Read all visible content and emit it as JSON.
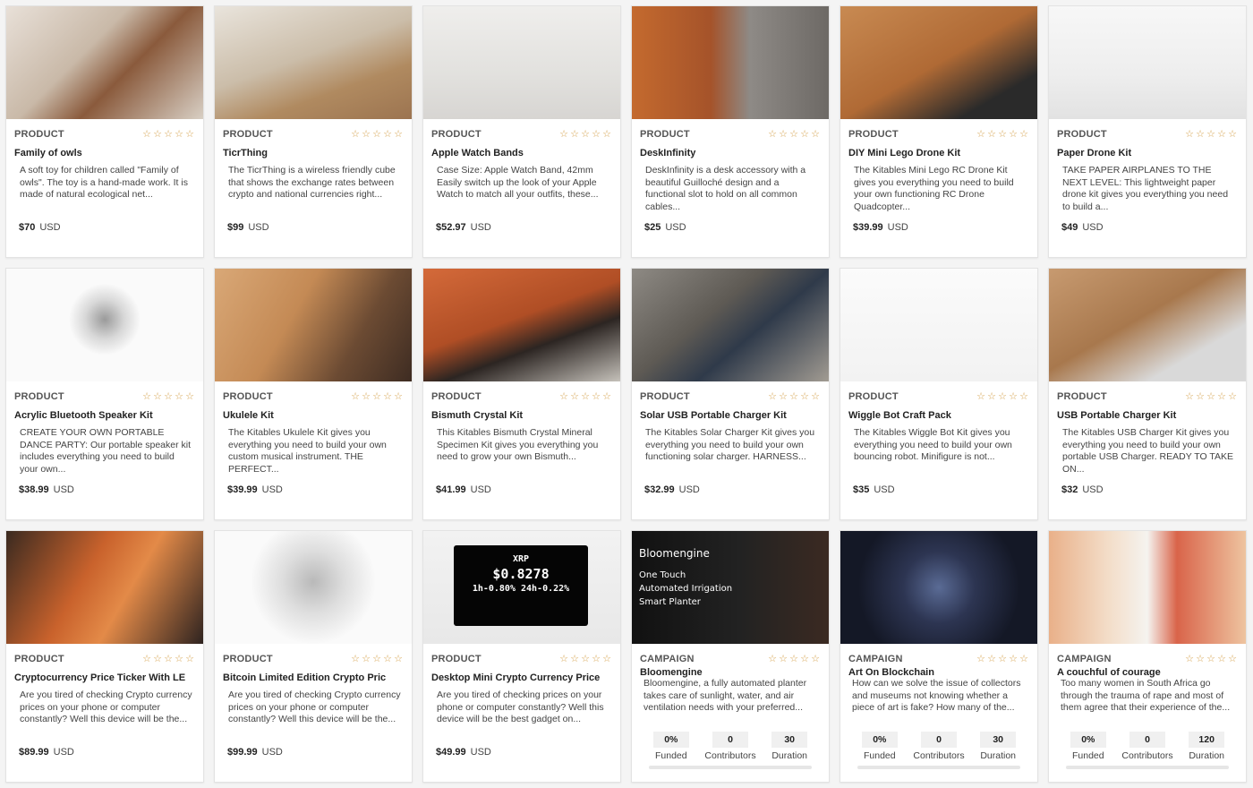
{
  "accent": "#e09a34",
  "star_icon": "star-outline-icon",
  "cards": [
    {
      "kind": "product",
      "type": "PRODUCT",
      "title": "Family of owls",
      "desc": "A soft toy for children called \"Family of owls\". The toy is a hand-made work. It is made of natural ecological net...",
      "price": "$70",
      "currency": "USD",
      "rating": 0,
      "image": "owls-image",
      "thumb": "linear-gradient(135deg,#e8e0d8,#c9b9a8 40%,#8a5a3c 60%,#d8cfc4)"
    },
    {
      "kind": "product",
      "type": "PRODUCT",
      "title": "TicrThing",
      "desc": "The TicrThing is a wireless friendly cube that shows the exchange rates between crypto and national currencies right...",
      "price": "$99",
      "currency": "USD",
      "rating": 0,
      "image": "ticrthing-image",
      "thumb": "linear-gradient(160deg,#e9e4dc,#cbbda9 45%,#b08a60 70%,#9c7450)"
    },
    {
      "kind": "product",
      "type": "PRODUCT",
      "title": "Apple Watch Bands",
      "desc": "Case Size: Apple Watch Band, 42mm Easily switch up the look of your Apple Watch to match all your outfits, these...",
      "price": "$52.97",
      "currency": "USD",
      "rating": 0,
      "image": "watch-image",
      "thumb": "linear-gradient(180deg,#efeeec,#e2e1de 60%,#d7d5d2)"
    },
    {
      "kind": "product",
      "type": "PRODUCT",
      "title": "DeskInfinity",
      "desc": "DeskInfinity is a desk accessory with a beautiful Guilloché design and a functional slot to hold on all common cables...",
      "price": "$25",
      "currency": "USD",
      "rating": 0,
      "image": "deskinfinity-image",
      "thumb": "linear-gradient(90deg,#c46a2e,#a5532a 40%,#8e8a86 60%,#6d6965)"
    },
    {
      "kind": "product",
      "type": "PRODUCT",
      "title": "DIY Mini Lego Drone Kit",
      "desc": "The Kitables Mini Lego RC Drone Kit gives you everything you need to build your own functioning RC Drone Quadcopter...",
      "price": "$39.99",
      "currency": "USD",
      "rating": 0,
      "image": "drone-image",
      "thumb": "linear-gradient(150deg,#c88a52,#b06a35 50%,#2a2a2a 80%)"
    },
    {
      "kind": "product",
      "type": "PRODUCT",
      "title": "Paper Drone Kit",
      "desc": "TAKE PAPER AIRPLANES TO THE NEXT LEVEL: This lightweight paper drone kit gives you everything you need to build a...",
      "price": "$49",
      "currency": "USD",
      "rating": 0,
      "image": "paper-drone-image",
      "thumb": "linear-gradient(180deg,#f7f7f7,#eeeeee 60%,#e2e2e2)"
    },
    {
      "kind": "product",
      "type": "PRODUCT",
      "title": "Acrylic Bluetooth Speaker Kit",
      "desc": "CREATE YOUR OWN PORTABLE DANCE PARTY: Our portable speaker kit includes everything you need to build your own...",
      "price": "$38.99",
      "currency": "USD",
      "rating": 0,
      "image": "speaker-image",
      "thumb": "radial-gradient(circle at 50% 45%,#9a9a9a 0,#d8d8d8 22px,#fafafa 40px)"
    },
    {
      "kind": "product",
      "type": "PRODUCT",
      "title": "Ukulele Kit",
      "desc": "The Kitables Ukulele Kit gives you everything you need to build your own custom musical instrument. THE PERFECT...",
      "price": "$39.99",
      "currency": "USD",
      "rating": 0,
      "image": "ukulele-image",
      "thumb": "linear-gradient(120deg,#d9a877,#c48a55 40%,#6c4b33 70%,#3e2c22)"
    },
    {
      "kind": "product",
      "type": "PRODUCT",
      "title": "Bismuth Crystal Kit",
      "desc": "This Kitables Bismuth Crystal Mineral Specimen Kit gives you everything you need to grow your own Bismuth...",
      "price": "$41.99",
      "currency": "USD",
      "rating": 0,
      "image": "bismuth-image",
      "thumb": "linear-gradient(160deg,#d46a3a,#b04e25 45%,#2c2522 65%,#c5c1ba)"
    },
    {
      "kind": "product",
      "type": "PRODUCT",
      "title": "Solar USB Portable Charger Kit",
      "desc": "The Kitables Solar Charger Kit gives you everything you need to build your own functioning solar charger. HARNESS...",
      "price": "$32.99",
      "currency": "USD",
      "rating": 0,
      "image": "solar-image",
      "thumb": "linear-gradient(140deg,#8e8a84,#5e5a54 40%,#2f3a4a 60%,#a19b92)"
    },
    {
      "kind": "product",
      "type": "PRODUCT",
      "title": "Wiggle Bot Craft Pack",
      "desc": "The Kitables Wiggle Bot Kit gives you everything you need to build your own bouncing robot. Minifigure is not...",
      "price": "$35",
      "currency": "USD",
      "rating": 0,
      "image": "wigglebot-image",
      "thumb": "linear-gradient(180deg,#fbfbfb,#f2f2f2)"
    },
    {
      "kind": "product",
      "type": "PRODUCT",
      "title": "USB Portable Charger Kit",
      "desc": "The Kitables USB Charger Kit gives you everything you need to build your own portable USB Charger. READY TO TAKE ON...",
      "price": "$32",
      "currency": "USD",
      "rating": 0,
      "image": "usb-charger-image",
      "thumb": "linear-gradient(150deg,#c79a70,#a8784d 45%,#d9d9d9 75%)"
    },
    {
      "kind": "product",
      "type": "PRODUCT",
      "title": "Cryptocurrency Price Ticker With LE",
      "desc": "Are you tired of checking Crypto currency prices on your phone or computer constantly? Well this device will be the...",
      "price": "$89.99",
      "currency": "USD",
      "rating": 0,
      "image": "ticker-image",
      "thumb": "linear-gradient(120deg,#3a2a20,#c9622c 40%,#e38a48 60%,#2e2320)"
    },
    {
      "kind": "product",
      "type": "PRODUCT",
      "title": "Bitcoin Limited Edition Crypto Pric",
      "desc": "Are you tired of checking Crypto currency prices on your phone or computer constantly? Well this device will be the...",
      "price": "$99.99",
      "currency": "USD",
      "rating": 0,
      "image": "bitcoin-image",
      "thumb": "radial-gradient(circle at 50% 45%,#b9b9b9 0,#dedede 35px,#fafafa 70px)"
    },
    {
      "kind": "product",
      "type": "PRODUCT",
      "title": "Desktop Mini Crypto Currency Price",
      "desc": "Are you tired of checking prices on your phone or computer constantly? Well this device will be the best gadget on...",
      "price": "$49.99",
      "currency": "USD",
      "rating": 0,
      "image": "mini-ticker-image",
      "thumb": "linear-gradient(180deg,#f2f2f2,#e8e8e8)",
      "screen": [
        "XRP",
        "$0.8278",
        "1h-0.80% 24h-0.22%"
      ]
    },
    {
      "kind": "campaign",
      "type": "CAMPAIGN",
      "title": "Bloomengine",
      "desc": "Bloomengine, a fully automated planter takes care of sunlight, water, and air ventilation needs with your preferred...",
      "funded": "0%",
      "funded_label": "Funded",
      "contributors": "0",
      "contributors_label": "Contributors",
      "duration": "30",
      "duration_label": "Duration",
      "progress": 0,
      "rating": 0,
      "image": "bloomengine-image",
      "thumb": "linear-gradient(90deg,#111,#222 55%,#3b2a22)",
      "captions": [
        "Bloomengine",
        "One Touch",
        "Automated Irrigation",
        "Smart Planter"
      ]
    },
    {
      "kind": "campaign",
      "type": "CAMPAIGN",
      "title": "Art On Blockchain",
      "desc": "How can we solve the issue of collectors and museums not knowing whether a piece of art is fake? How many of the...",
      "funded": "0%",
      "funded_label": "Funded",
      "contributors": "0",
      "contributors_label": "Contributors",
      "duration": "30",
      "duration_label": "Duration",
      "progress": 0,
      "rating": 0,
      "image": "blockchain-art-image",
      "thumb": "radial-gradient(circle at 50% 50%,#5a6b95 0,#2d3552 40px,#141826 90px)"
    },
    {
      "kind": "campaign",
      "type": "CAMPAIGN",
      "title": "A couchful of courage",
      "desc": "Too many women in South Africa go through the trauma of rape and most of them agree that their experience of the...",
      "funded": "0%",
      "funded_label": "Funded",
      "contributors": "0",
      "contributors_label": "Contributors",
      "duration": "120",
      "duration_label": "Duration",
      "progress": 0,
      "rating": 0,
      "image": "courage-image",
      "thumb": "linear-gradient(90deg,#e9b089,#f3ddc8 30%,#f5f3ef 50%,#d9644a 65%,#eec4a0)"
    }
  ]
}
